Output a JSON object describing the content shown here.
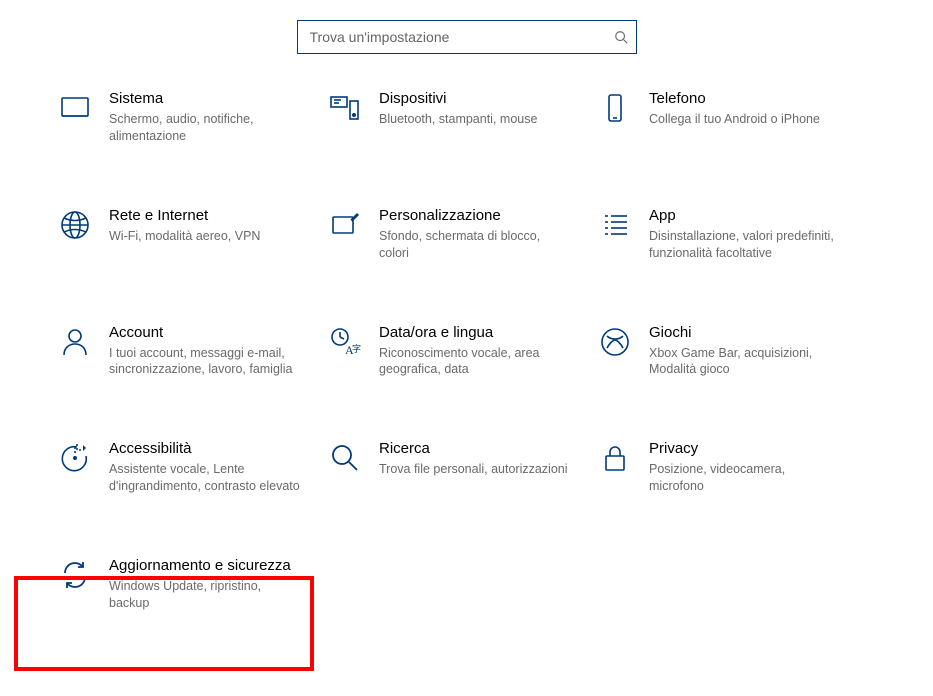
{
  "search": {
    "placeholder": "Trova un'impostazione"
  },
  "categories": [
    {
      "id": "system",
      "title": "Sistema",
      "desc": "Schermo, audio, notifiche, alimentazione"
    },
    {
      "id": "devices",
      "title": "Dispositivi",
      "desc": "Bluetooth, stampanti, mouse"
    },
    {
      "id": "phone",
      "title": "Telefono",
      "desc": "Collega il tuo Android o iPhone"
    },
    {
      "id": "network",
      "title": "Rete e Internet",
      "desc": "Wi-Fi, modalità aereo, VPN"
    },
    {
      "id": "personalization",
      "title": "Personalizzazione",
      "desc": "Sfondo, schermata di blocco, colori"
    },
    {
      "id": "apps",
      "title": "App",
      "desc": "Disinstallazione, valori predefiniti, funzionalità facoltative"
    },
    {
      "id": "accounts",
      "title": "Account",
      "desc": "I tuoi account, messaggi e-mail, sincronizzazione, lavoro, famiglia"
    },
    {
      "id": "time",
      "title": "Data/ora e lingua",
      "desc": "Riconoscimento vocale, area geografica, data"
    },
    {
      "id": "gaming",
      "title": "Giochi",
      "desc": "Xbox Game Bar, acquisizioni, Modalità gioco"
    },
    {
      "id": "ease",
      "title": "Accessibilità",
      "desc": "Assistente vocale, Lente d'ingrandimento, contrasto elevato"
    },
    {
      "id": "search-cat",
      "title": "Ricerca",
      "desc": "Trova file personali, autorizzazioni"
    },
    {
      "id": "privacy",
      "title": "Privacy",
      "desc": "Posizione, videocamera, microfono"
    },
    {
      "id": "update",
      "title": "Aggiornamento e sicurezza",
      "desc": "Windows Update, ripristino, backup"
    }
  ]
}
